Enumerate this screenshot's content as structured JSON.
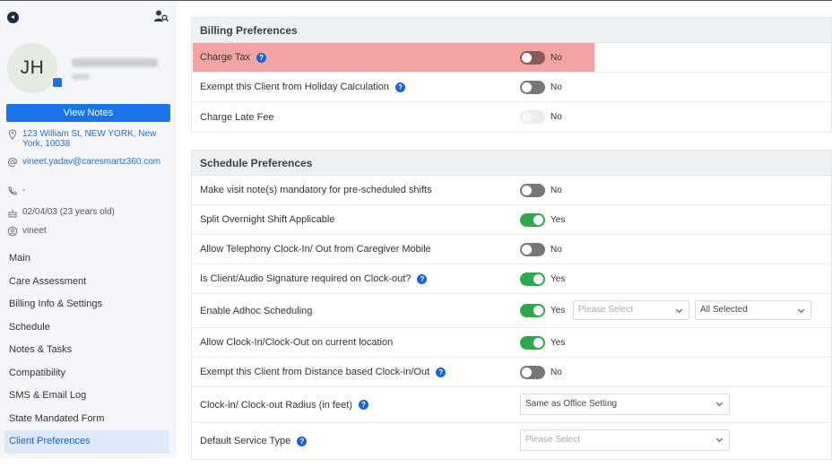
{
  "sidebar": {
    "avatar_initials": "JH",
    "view_notes_label": "View Notes",
    "address": "123 William St, NEW YORK, New York, 10038",
    "email": "vineet.yadav@caresmartz360.com",
    "phone": "-",
    "dob": "02/04/03 (23 years old)",
    "user": "vineet",
    "menu": [
      {
        "label": "Main"
      },
      {
        "label": "Care Assessment"
      },
      {
        "label": "Billing Info & Settings"
      },
      {
        "label": "Schedule"
      },
      {
        "label": "Notes & Tasks"
      },
      {
        "label": "Compatibility"
      },
      {
        "label": "SMS & Email Log"
      },
      {
        "label": "State Mandated Form"
      },
      {
        "label": "Client Preferences",
        "active": true
      }
    ]
  },
  "billing": {
    "title": "Billing Preferences",
    "rows": [
      {
        "label": "Charge Tax",
        "value": "No"
      },
      {
        "label": "Exempt this Client from Holiday Calculation",
        "value": "No"
      },
      {
        "label": "Charge Late Fee",
        "value": "No"
      }
    ]
  },
  "schedule": {
    "title": "Schedule Preferences",
    "rows": [
      {
        "label": "Make visit note(s) mandatory for pre-scheduled shifts",
        "value": "No"
      },
      {
        "label": "Split Overnight Shift Applicable",
        "value": "Yes"
      },
      {
        "label": "Allow Telephony Clock-In/ Out from Caregiver Mobile",
        "value": "No"
      },
      {
        "label": "Is Client/Audio Signature required on Clock-out?",
        "value": "Yes"
      },
      {
        "label": "Enable Adhoc Scheduling",
        "value": "Yes",
        "select1_placeholder": "Please Select",
        "select2_value": "All Selected"
      },
      {
        "label": "Allow Clock-In/Clock-Out on current location",
        "value": "Yes"
      },
      {
        "label": "Exempt this Client from Distance based Clock-in/Out",
        "value": "No"
      },
      {
        "label": "Clock-in/ Clock-out Radius (in feet)",
        "select_value": "Same as Office Setting"
      },
      {
        "label": "Default Service Type",
        "select_placeholder": "Please Select"
      }
    ]
  },
  "colors": {
    "accent": "#1a73e8",
    "toggle_on": "#2ea84a",
    "highlight": "#f4a4a4"
  }
}
